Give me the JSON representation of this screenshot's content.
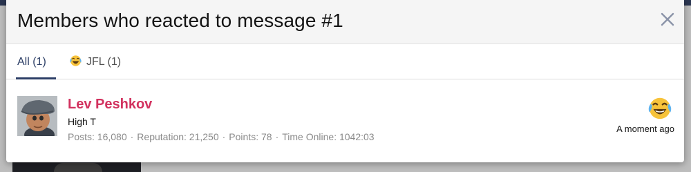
{
  "overlay": {
    "title": "Members who reacted to message #1",
    "close_icon": "close-icon"
  },
  "tabs": [
    {
      "label": "All (1)",
      "active": true
    },
    {
      "label": "JFL (1)",
      "icon": "joy-face-icon",
      "active": false
    }
  ],
  "member": {
    "name": "Lev Peshkov",
    "title": "High T",
    "stats": [
      {
        "label": "Posts",
        "value": "16,080"
      },
      {
        "label": "Reputation",
        "value": "21,250"
      },
      {
        "label": "Points",
        "value": "78"
      },
      {
        "label": "Time Online",
        "value": "1042:03"
      }
    ],
    "reaction_icon": "joy-face-icon",
    "reaction_time": "A moment ago"
  },
  "colors": {
    "accent": "#2c3e66",
    "username": "#d2325f",
    "muted": "#8a8a8a"
  }
}
